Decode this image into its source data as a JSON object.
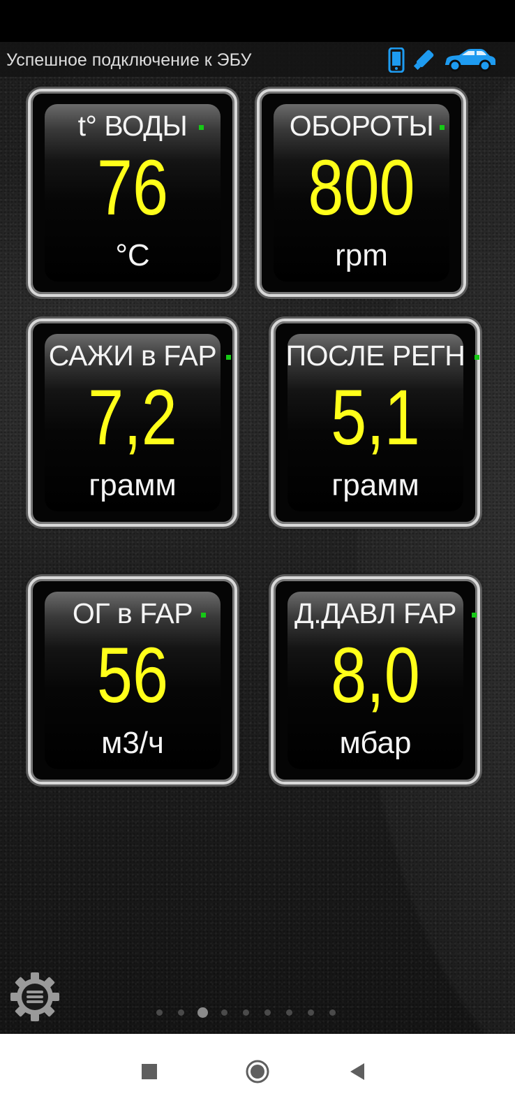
{
  "status": {
    "connection_text": "Успешное подключение к ЭБУ"
  },
  "icons": {
    "phone": "phone-icon",
    "adapter": "usb-adapter-icon",
    "car": "car-icon",
    "settings": "gear-icon",
    "accent_color": "#1e9bf0"
  },
  "gauges": [
    {
      "title": "t° ВОДЫ",
      "value": "76",
      "unit": "°C"
    },
    {
      "title": "ОБОРОТЫ",
      "value": "800",
      "unit": "rpm"
    },
    {
      "title": "САЖИ в FAP",
      "value": "7,2",
      "unit": "грамм"
    },
    {
      "title": "ПОСЛЕ РЕГН",
      "value": "5,1",
      "unit": "грамм"
    },
    {
      "title": "ОГ в FAP",
      "value": "56",
      "unit": "м3/ч"
    },
    {
      "title": "Д.ДАВЛ FAP",
      "value": "8,0",
      "unit": "мбар"
    }
  ],
  "colors": {
    "value": "#ffff1a",
    "indicator": "#16c916"
  },
  "pager": {
    "total": 9,
    "current": 3
  },
  "navigation": {
    "buttons": [
      "recent-apps",
      "home",
      "back"
    ]
  }
}
